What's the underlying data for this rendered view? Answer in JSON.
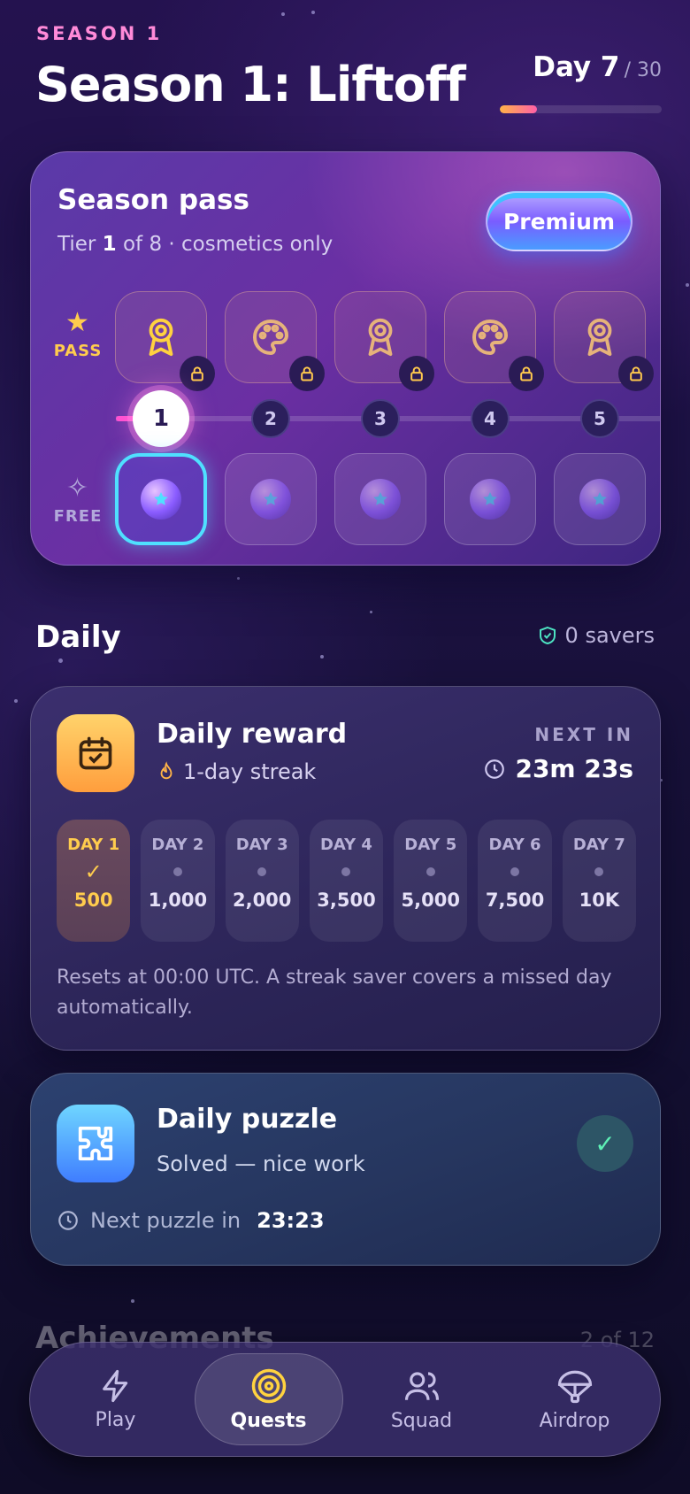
{
  "header": {
    "season_label": "SEASON 1",
    "title": "Season 1: Liftoff",
    "day_current": "Day 7",
    "day_total": "/ 30",
    "day_progress": 0.23
  },
  "season_pass": {
    "title": "Season pass",
    "tier_current": "1",
    "subtitle_prefix": "Tier ",
    "subtitle_suffix": " of 8 · cosmetics only",
    "premium_button": "Premium",
    "pass_row_label": "PASS",
    "free_row_label": "FREE",
    "tiers": [
      {
        "num": "1",
        "pass_icon": "medal-icon"
      },
      {
        "num": "2",
        "pass_icon": "palette-icon"
      },
      {
        "num": "3",
        "pass_icon": "medal-icon"
      },
      {
        "num": "4",
        "pass_icon": "palette-icon"
      },
      {
        "num": "5",
        "pass_icon": "medal-icon"
      }
    ]
  },
  "daily": {
    "title": "Daily",
    "savers": "0 savers"
  },
  "daily_reward": {
    "title": "Daily reward",
    "streak": "1-day streak",
    "next_label": "NEXT IN",
    "next_time": "23m 23s",
    "days": [
      {
        "name": "DAY 1",
        "value": "500"
      },
      {
        "name": "DAY 2",
        "value": "1,000"
      },
      {
        "name": "DAY 3",
        "value": "2,000"
      },
      {
        "name": "DAY 4",
        "value": "3,500"
      },
      {
        "name": "DAY 5",
        "value": "5,000"
      },
      {
        "name": "DAY 6",
        "value": "7,500"
      },
      {
        "name": "DAY 7",
        "value": "10K"
      }
    ],
    "note": "Resets at 00:00 UTC. A streak saver covers a missed day automatically."
  },
  "daily_puzzle": {
    "title": "Daily puzzle",
    "status": "Solved — nice work",
    "next_label": "Next puzzle in",
    "next_time": "23:23"
  },
  "achievements": {
    "title": "Achievements",
    "count": "2 of 12"
  },
  "nav": {
    "items": [
      {
        "label": "Play"
      },
      {
        "label": "Quests"
      },
      {
        "label": "Squad"
      },
      {
        "label": "Airdrop"
      }
    ]
  },
  "colors": {
    "accent_pink": "#ff8ad8",
    "gold": "#ffcc4d",
    "cyan": "#4fe0ff"
  }
}
